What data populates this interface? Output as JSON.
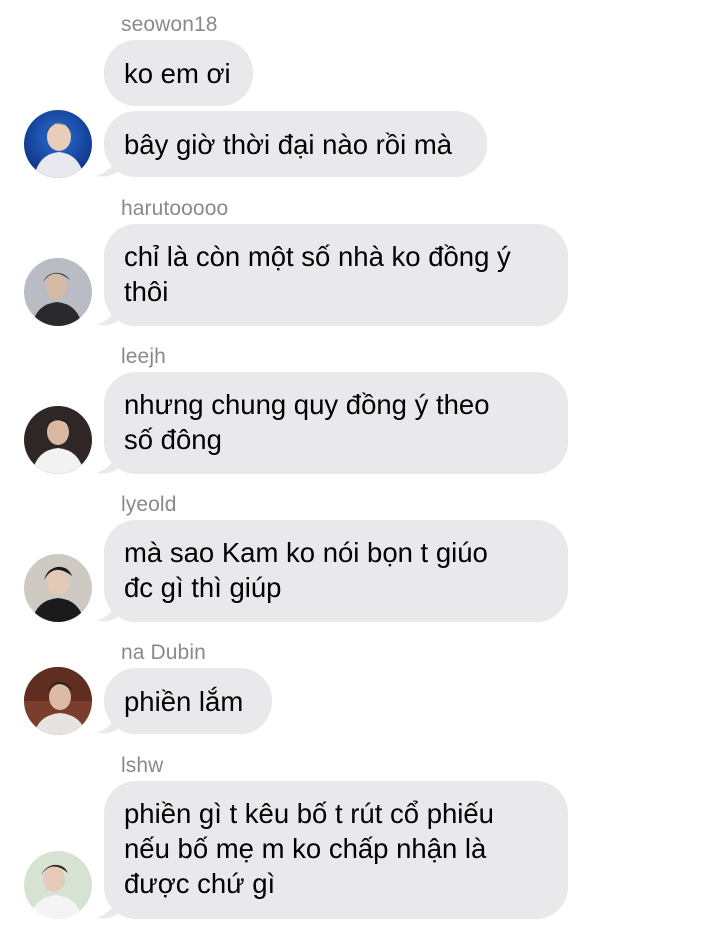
{
  "conversation": {
    "groups": [
      {
        "sender": "seowon18",
        "messages": [
          "ko em ơi",
          "bây giờ thời đại nào rồi mà"
        ]
      },
      {
        "sender": "harutooooo",
        "messages": [
          [
            "chỉ là còn một số nhà ko đồng ý",
            "thôi"
          ]
        ]
      },
      {
        "sender": "leejh",
        "messages": [
          [
            "nhưng chung quy đồng ý theo",
            "số đông"
          ]
        ]
      },
      {
        "sender": "lyeold",
        "messages": [
          [
            "mà sao Kam ko nói bọn t giúo",
            "đc gì thì giúp"
          ]
        ]
      },
      {
        "sender": "na Dubin",
        "messages": [
          "phiền lắm"
        ]
      },
      {
        "sender": "lshw",
        "messages": [
          [
            "phiền gì t kêu bố t rút cổ phiếu",
            "nếu bố mẹ m ko chấp nhận là",
            "được chứ gì"
          ]
        ]
      }
    ]
  },
  "colors": {
    "bubble": "#e9e9eb",
    "sender_name": "#8a8a8e",
    "text": "#000000",
    "background": "#ffffff"
  }
}
